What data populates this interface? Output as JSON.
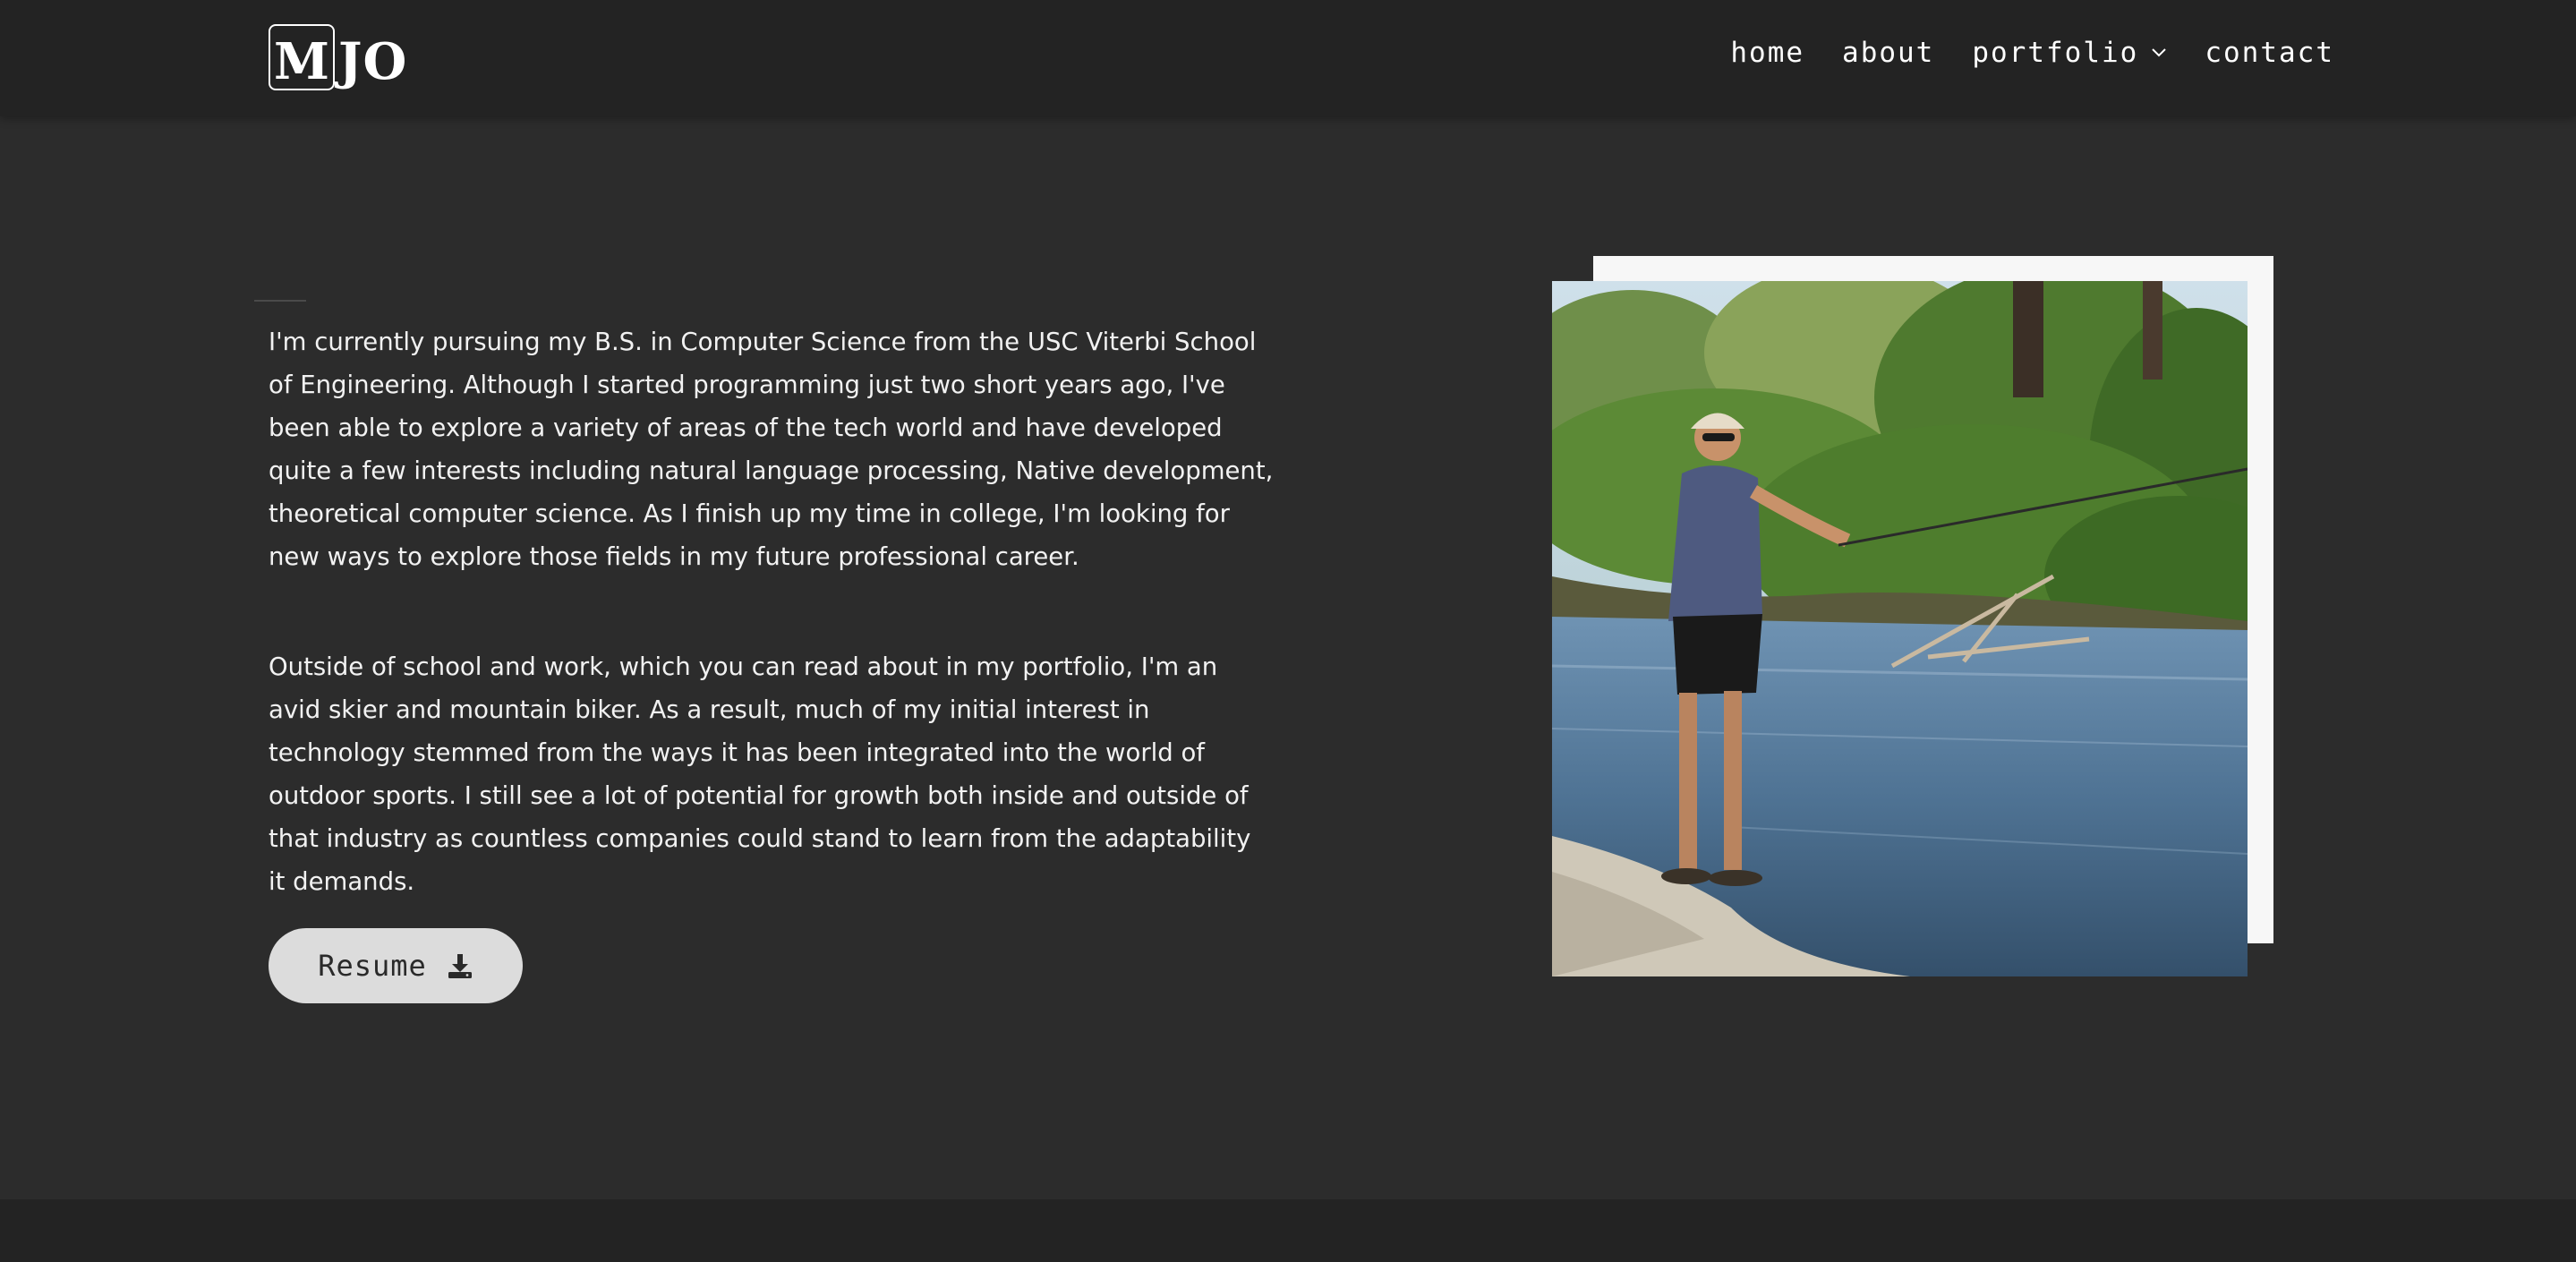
{
  "header": {
    "logo": {
      "boxed_letter": "M",
      "rest": "JO"
    },
    "nav": {
      "home": "home",
      "about": "about",
      "portfolio": "portfolio",
      "contact": "contact"
    }
  },
  "about": {
    "paragraph_1": "I'm currently pursuing my B.S. in Computer Science from the USC Viterbi School of Engineering. Although I started programming just two short years ago, I've been able to explore a variety of areas of the tech world and have developed quite a few interests including natural language processing, Native development, theoretical computer science. As I finish up my time in college, I'm looking for new ways to explore those fields in my future professional career.",
    "paragraph_2": "Outside of school and work, which you can read about in my portfolio, I'm an avid skier and mountain biker. As a result, much of my initial interest in technology stemmed from the ways it has been integrated into the world of outdoor sports. I still see a lot of potential for growth both inside and outside of that industry as countless companies could stand to learn from the adaptability it demands.",
    "resume_label": "Resume",
    "resume_icon": "download-icon"
  },
  "colors": {
    "background": "#2c2c2c",
    "navbar": "#232323",
    "text": "#f2f2f2",
    "button_bg": "#dcdcdc",
    "photo_frame": "#f7f7f7"
  }
}
